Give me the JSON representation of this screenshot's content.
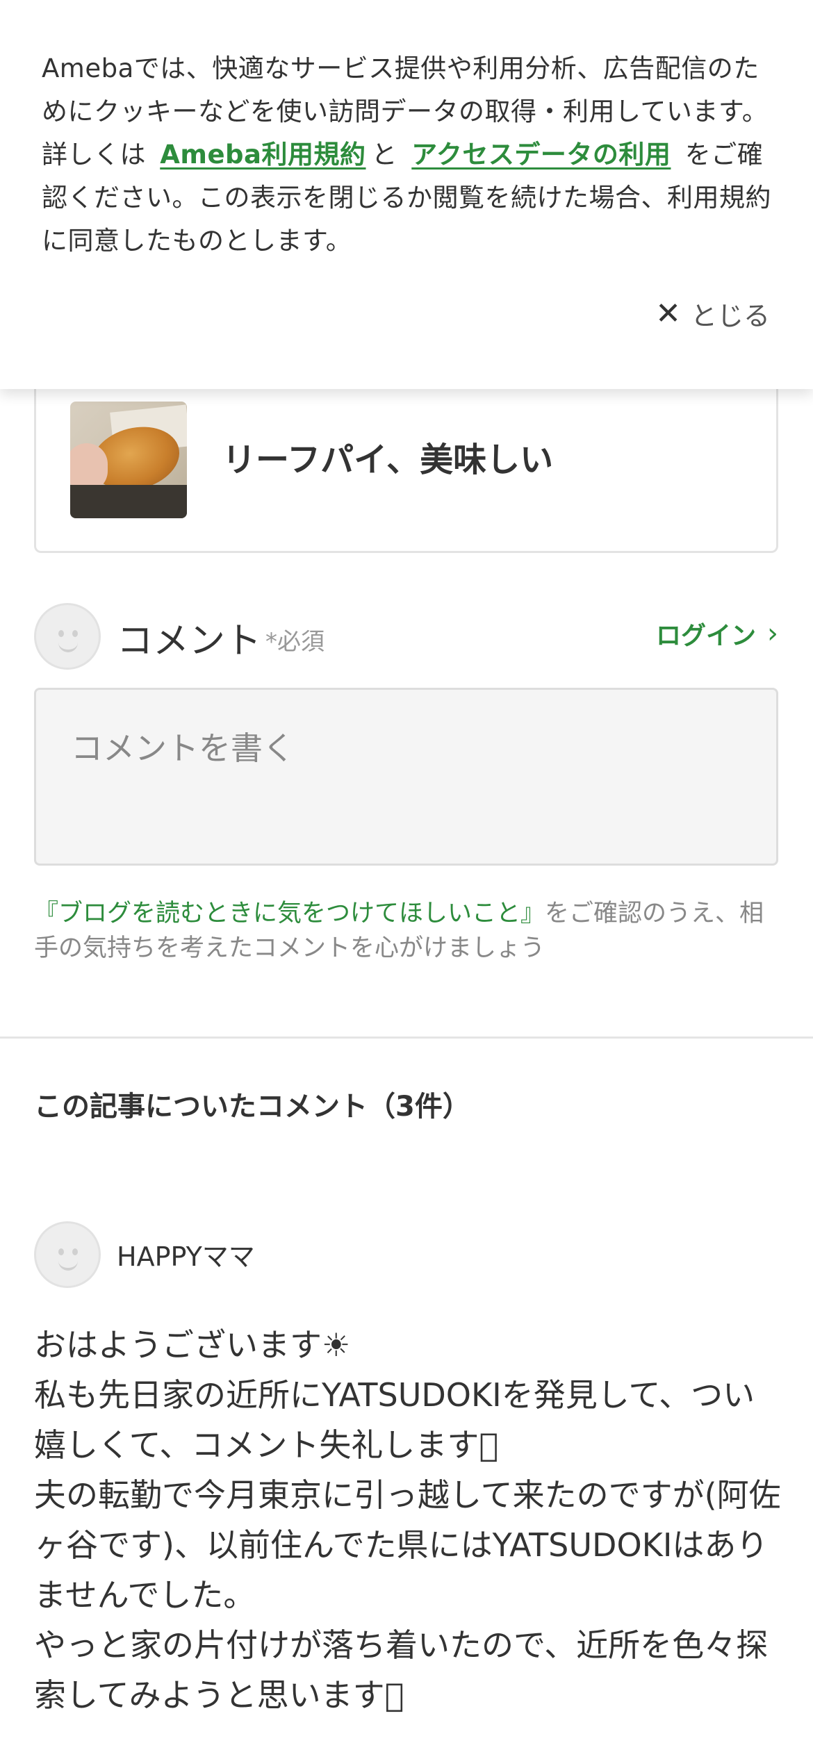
{
  "cookie_banner": {
    "text_before": "Amebaでは、快適なサービス提供や利用分析、広告配信のためにクッキーなどを使い訪問データの取得・利用しています。詳しくは",
    "link_terms": "Ameba利用規約",
    "connector": "と",
    "link_access": "アクセスデータの利用",
    "text_after": "をご確認ください。この表示を閉じるか閲覧を続けた場合、利用規約に同意したものとします。",
    "close_label": "とじる",
    "close_icon": "close-icon"
  },
  "article_card": {
    "title": "リーフパイ、美味しい"
  },
  "comment_form": {
    "label": "コメント",
    "required": "*必須",
    "login": "ログイン",
    "placeholder": "コメントを書く",
    "guide_link": "『ブログを読むときに気をつけてほしいこと』",
    "guide_text": "をご確認のうえ、相手の気持ちを考えたコメントを心がけましょう"
  },
  "comments_section": {
    "title": "この記事についたコメント（3件）",
    "comments": [
      {
        "author": "HAPPYママ",
        "body": "おはようございます☀\n私も先日家の近所にYATSUDOKIを発見して、つい嬉しくて、コメント失礼します􀀀\n夫の転勤で今月東京に引っ越して来たのですが(阿佐ヶ谷です)、以前住んでた県にはYATSUDOKIはありませんでした。\nやっと家の片付けが落ち着いたので、近所を色々探索してみようと思います􀀀"
      }
    ]
  },
  "colors": {
    "accent_green": "#2d8c3c",
    "text": "#333333",
    "muted": "#888888"
  }
}
